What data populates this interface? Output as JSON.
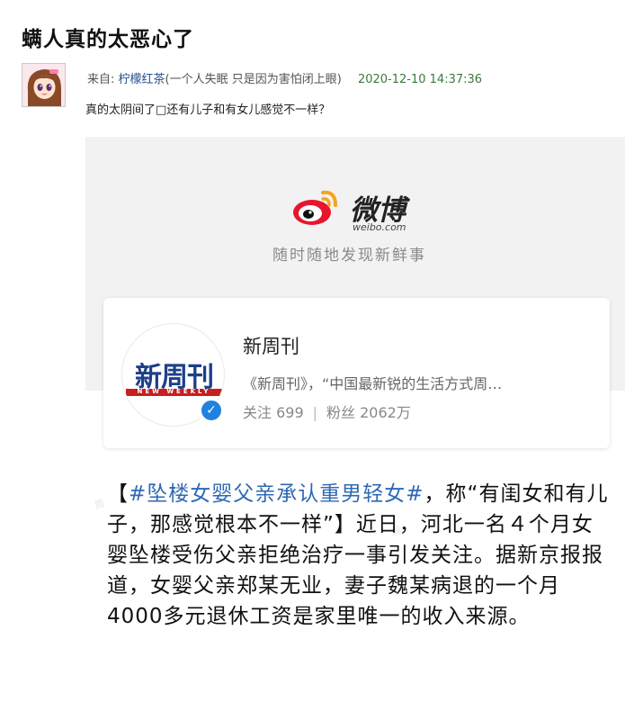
{
  "post": {
    "title": "螨人真的太恶心了",
    "meta_from": "来自:",
    "author": "柠檬红茶",
    "author_note": "(一个人失眠 只是因为害怕闭上眼)",
    "timestamp": "2020-12-10 14:37:36",
    "text": "真的太阴间了□还有儿子和有女儿感觉不一样？"
  },
  "share": {
    "weibo_name": "微博",
    "weibo_domain": "weibo.com",
    "slogan": "随时随地发现新鲜事",
    "card": {
      "logo_text": "新周刊",
      "logo_stripe": "NEW WEEKLY",
      "name": "新周刊",
      "description": "《新周刊》，“中国最新锐的生活方式周…",
      "following_label": "关注 699",
      "followers_label": "粉丝 2062万",
      "separator": "|"
    },
    "article": {
      "open_bracket": "【",
      "hashtag": "#坠楼女婴父亲承认重男轻女#",
      "body": "，称“有闺女和有儿子，那感觉根本不一样”】近日，河北一名４个月女婴坠楼受伤父亲拒绝治疗一事引发关注。据新京报报道，女婴父亲郑某无业，妻子魏某病退的一个月4000多元退休工资是家里唯一的收入来源。"
    }
  },
  "colors": {
    "author_link": "#2a4f8f",
    "timestamp": "#3b7a3b",
    "hashtag": "#2f69b4",
    "weibo_red": "#e6162d",
    "weibo_orange": "#f7a31c",
    "verify_blue": "#1f82e0"
  },
  "icons": {
    "verified": "verified-v-icon",
    "weibo": "weibo-eye-logo-icon"
  }
}
